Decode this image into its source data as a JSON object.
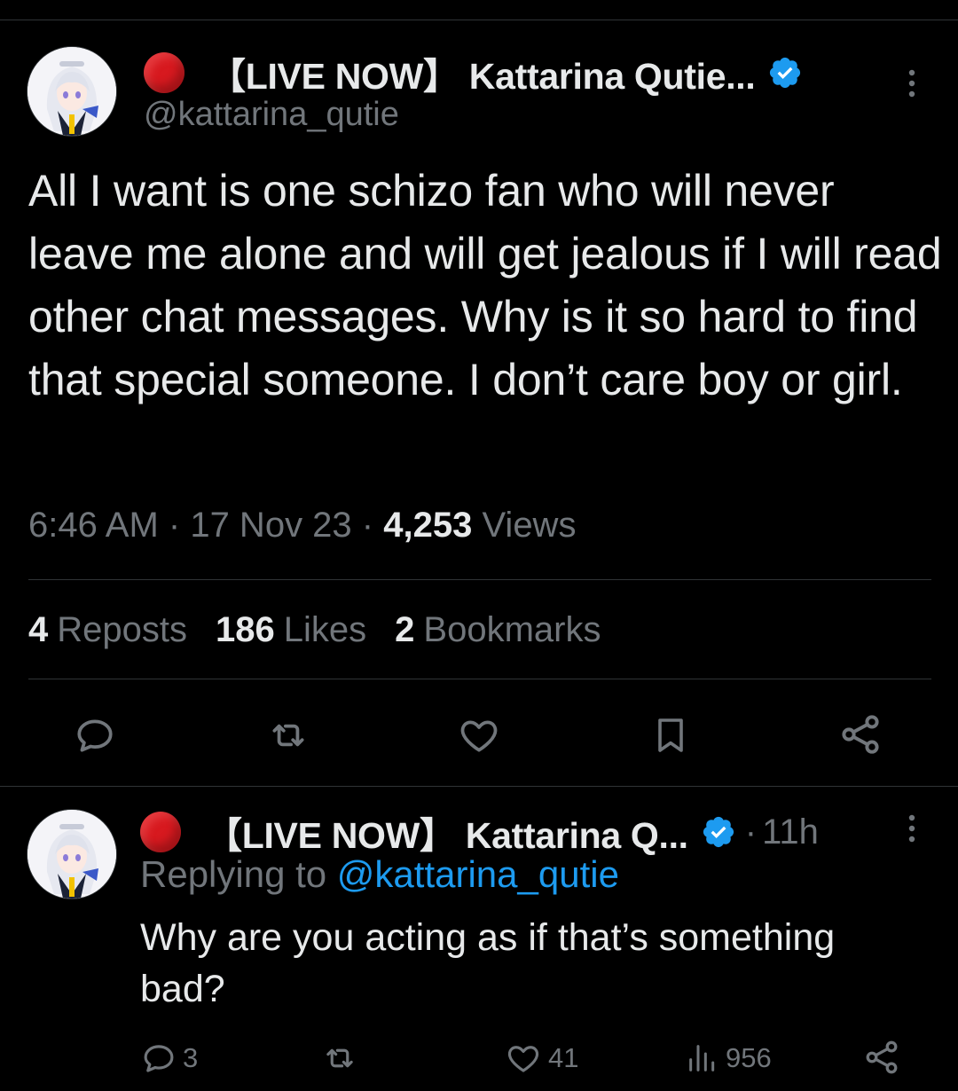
{
  "tweet": {
    "display_name": "【LIVE NOW】 Kattarina Qutie...",
    "handle": "@kattarina_qutie",
    "text": "All I want is one schizo fan who will never leave me alone and will get jealous if I will read other chat messages. Why is it so hard to find that special someone. I don’t care boy or girl.",
    "time": "6:46 AM",
    "date": "17 Nov 23",
    "views_count": "4,253",
    "views_label": "Views",
    "reposts_count": "4",
    "reposts_label": "Reposts",
    "likes_count": "186",
    "likes_label": "Likes",
    "bookmarks_count": "2",
    "bookmarks_label": "Bookmarks"
  },
  "reply": {
    "display_name": "【LIVE NOW】 Kattarina Q...",
    "time_ago": "11h",
    "replying_to_label": "Replying to",
    "replying_to_handle": "@kattarina_qutie",
    "text": "Why are you acting as if that’s something bad?",
    "replies_count": "3",
    "likes_count": "41",
    "views_count": "956"
  },
  "icons": {
    "live_indicator": "red-circle",
    "verified": "verified-badge-icon",
    "more": "more-vertical-icon",
    "reply": "reply-icon",
    "repost": "repost-icon",
    "like": "heart-icon",
    "bookmark": "bookmark-icon",
    "share": "share-icon",
    "views": "views-icon"
  },
  "colors": {
    "background": "#000000",
    "text": "#e7e9ea",
    "muted": "#71767b",
    "accent": "#1d9bf0",
    "live_dot": "#d7191f",
    "divider": "#2f3336"
  }
}
